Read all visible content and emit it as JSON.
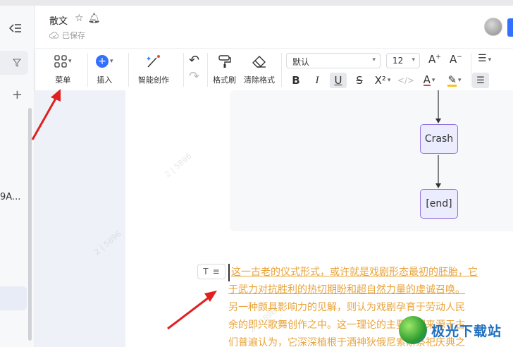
{
  "header": {
    "title": "散文",
    "save_status": "已保存"
  },
  "sidebar": {
    "doc_snippet": "9A..."
  },
  "toolbar": {
    "menu_label": "菜单",
    "insert_label": "插入",
    "ai_label": "智能创作",
    "format_painter_label": "格式刷",
    "clear_format_label": "清除格式",
    "font_family": "默认",
    "font_size": "12",
    "bold": "B",
    "italic": "I",
    "underline": "U",
    "strike": "S",
    "superscript": "X²",
    "font_color_glyph": "A"
  },
  "flowchart": {
    "nodes": [
      "Crash",
      "[end]"
    ]
  },
  "article": {
    "line1": "这一古老的仪式形式，或许就是戏剧形态最初的胚胎，它",
    "line2": "于武力对抗胜利的热切期盼和超自然力量的虔诚召唤。",
    "line3": "另一种颇具影响力的见解，则认为戏剧孕育于劳动人民",
    "line4": "余的即兴歌舞创作之中。这一理论的主要依据来源于古",
    "line5": "们普遍认为，它深深植根于酒神狄俄尼索斯祭祀庆典之"
  },
  "logo": {
    "text": "极光下载站"
  },
  "colors": {
    "accent": "#3370ff",
    "annotation_arrow": "#e02020",
    "article_text": "#e8a33a",
    "node_fill": "#ececff",
    "node_border": "#9370db"
  }
}
